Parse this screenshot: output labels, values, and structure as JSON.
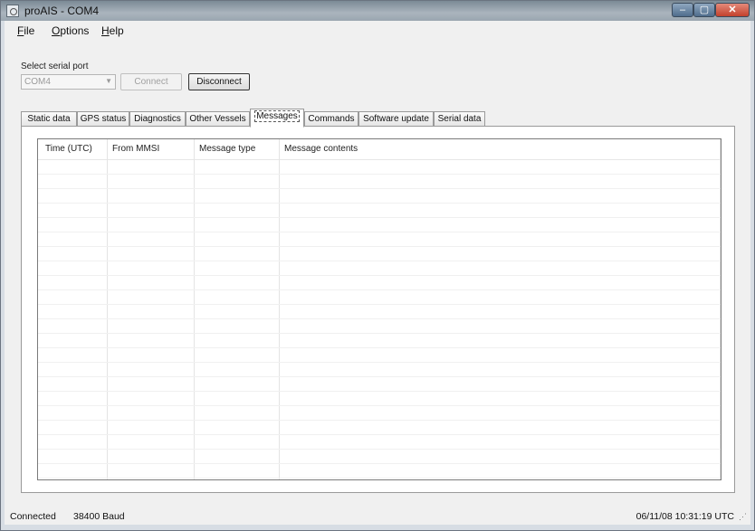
{
  "window": {
    "title": "proAIS - COM4",
    "min_label": "–",
    "max_label": "▢",
    "close_label": "✕"
  },
  "menu": [
    {
      "pre": "",
      "u": "F",
      "post": "ile"
    },
    {
      "pre": "",
      "u": "O",
      "post": "ptions"
    },
    {
      "pre": "",
      "u": "H",
      "post": "elp"
    }
  ],
  "serial": {
    "label": "Select serial port",
    "value": "COM4",
    "connect_label": "Connect",
    "disconnect_label": "Disconnect"
  },
  "tabs": [
    {
      "label": "Static data"
    },
    {
      "label": "GPS status"
    },
    {
      "label": "Diagnostics"
    },
    {
      "label": "Other Vessels"
    },
    {
      "label": "Messages",
      "active": true
    },
    {
      "label": "Commands"
    },
    {
      "label": "Software update"
    },
    {
      "label": "Serial data"
    }
  ],
  "messages_table": {
    "columns": [
      "Time (UTC)",
      "From MMSI",
      "Message type",
      "Message contents"
    ],
    "rows": []
  },
  "status": {
    "connection": "Connected",
    "baud": "38400 Baud",
    "datetime": "06/11/08 10:31:19 UTC"
  }
}
